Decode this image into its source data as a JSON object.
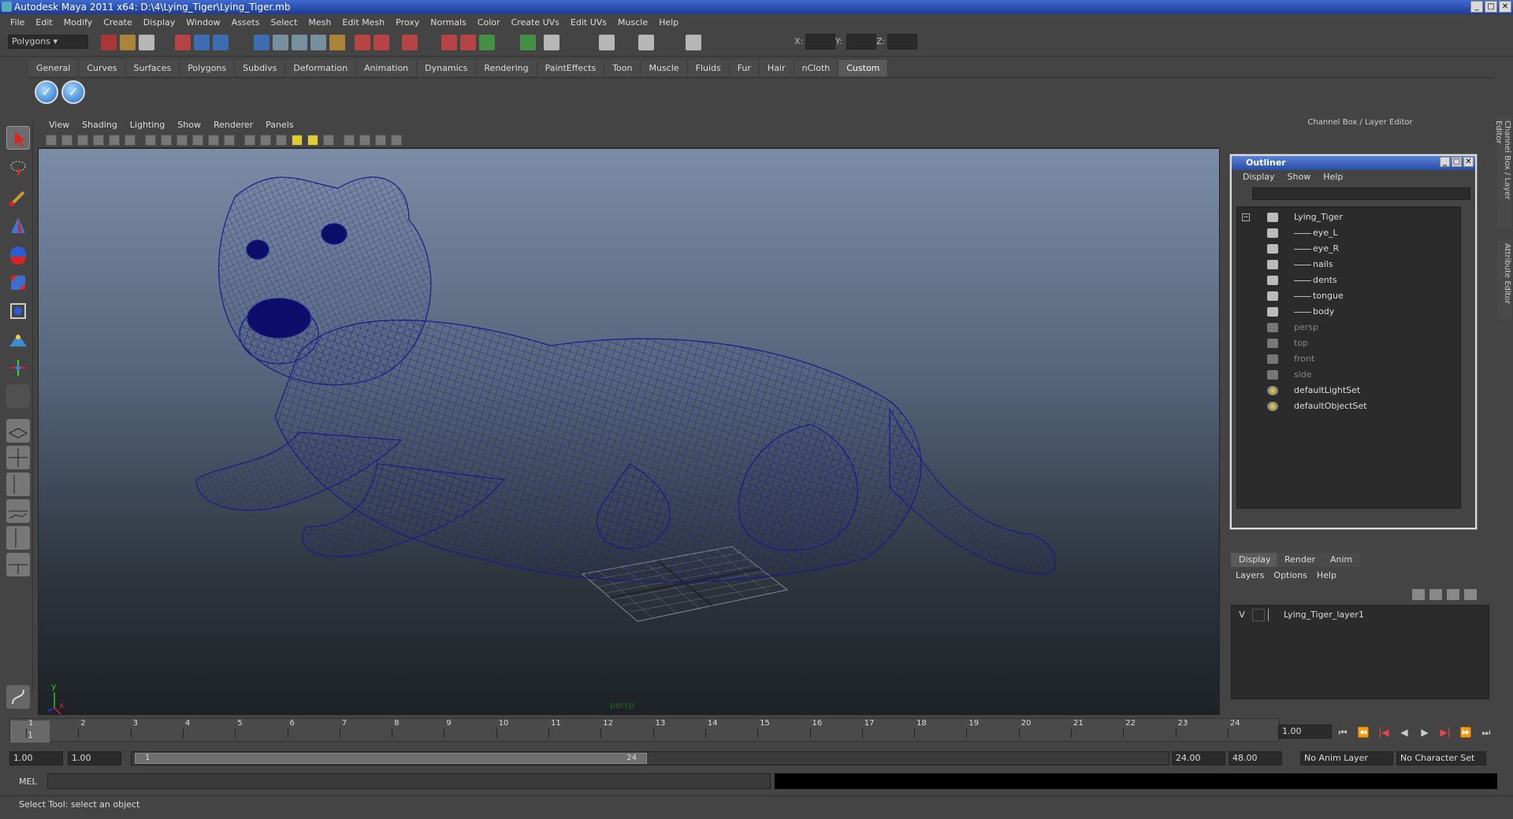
{
  "window": {
    "title": "Autodesk Maya 2011 x64: D:\\4\\Lying_Tiger\\Lying_Tiger.mb"
  },
  "menubar": [
    "File",
    "Edit",
    "Modify",
    "Create",
    "Display",
    "Window",
    "Assets",
    "Select",
    "Mesh",
    "Edit Mesh",
    "Proxy",
    "Normals",
    "Color",
    "Create UVs",
    "Edit UVs",
    "Muscle",
    "Help"
  ],
  "toolbar": {
    "mode": "Polygons",
    "x_label": "X:",
    "y_label": "Y:",
    "z_label": "Z:"
  },
  "shelf_tabs": [
    "General",
    "Curves",
    "Surfaces",
    "Polygons",
    "Subdivs",
    "Deformation",
    "Animation",
    "Dynamics",
    "Rendering",
    "PaintEffects",
    "Toon",
    "Muscle",
    "Fluids",
    "Fur",
    "Hair",
    "nCloth",
    "Custom"
  ],
  "shelf_active": "Custom",
  "viewport": {
    "menu": [
      "View",
      "Shading",
      "Lighting",
      "Show",
      "Renderer",
      "Panels"
    ],
    "camera_label": "persp",
    "axis_x": "x",
    "axis_y": "y"
  },
  "channel_box": {
    "title": "Channel Box / Layer Editor"
  },
  "outliner": {
    "title": "Outliner",
    "menu": [
      "Display",
      "Show",
      "Help"
    ],
    "items": [
      {
        "label": "Lying_Tiger",
        "dim": false,
        "indent": 0
      },
      {
        "label": "eye_L",
        "dim": false,
        "indent": 1
      },
      {
        "label": "eye_R",
        "dim": false,
        "indent": 1
      },
      {
        "label": "nails",
        "dim": false,
        "indent": 1
      },
      {
        "label": "dents",
        "dim": false,
        "indent": 1
      },
      {
        "label": "tongue",
        "dim": false,
        "indent": 1
      },
      {
        "label": "body",
        "dim": false,
        "indent": 1
      },
      {
        "label": "persp",
        "dim": true,
        "indent": 0
      },
      {
        "label": "top",
        "dim": true,
        "indent": 0
      },
      {
        "label": "front",
        "dim": true,
        "indent": 0
      },
      {
        "label": "side",
        "dim": true,
        "indent": 0
      },
      {
        "label": "defaultLightSet",
        "dim": false,
        "indent": 0
      },
      {
        "label": "defaultObjectSet",
        "dim": false,
        "indent": 0
      }
    ]
  },
  "layers": {
    "tabs": [
      "Display",
      "Render",
      "Anim"
    ],
    "menu": [
      "Layers",
      "Options",
      "Help"
    ],
    "rows": [
      {
        "visible": "V",
        "name": "Lying_Tiger_layer1"
      }
    ]
  },
  "side_tabs": [
    "Channel Box / Layer Editor",
    "Attribute Editor"
  ],
  "timeline": {
    "ticks": [
      "1",
      "2",
      "3",
      "4",
      "5",
      "6",
      "7",
      "8",
      "9",
      "10",
      "11",
      "12",
      "13",
      "14",
      "15",
      "16",
      "17",
      "18",
      "19",
      "20",
      "21",
      "22",
      "23",
      "24"
    ],
    "current_frame": "1",
    "current_field": "1.00"
  },
  "range": {
    "start": "1.00",
    "start2": "1.00",
    "slider_start": "1",
    "slider_end": "24",
    "end": "24.00",
    "end2": "48.00",
    "anim_layer": "No Anim Layer",
    "char_set": "No Character Set"
  },
  "mel": {
    "label": "MEL"
  },
  "status": {
    "text": "Select Tool: select an object"
  },
  "colors": {
    "wire": "#1a1a8a",
    "accent": "#2a4ea6"
  }
}
